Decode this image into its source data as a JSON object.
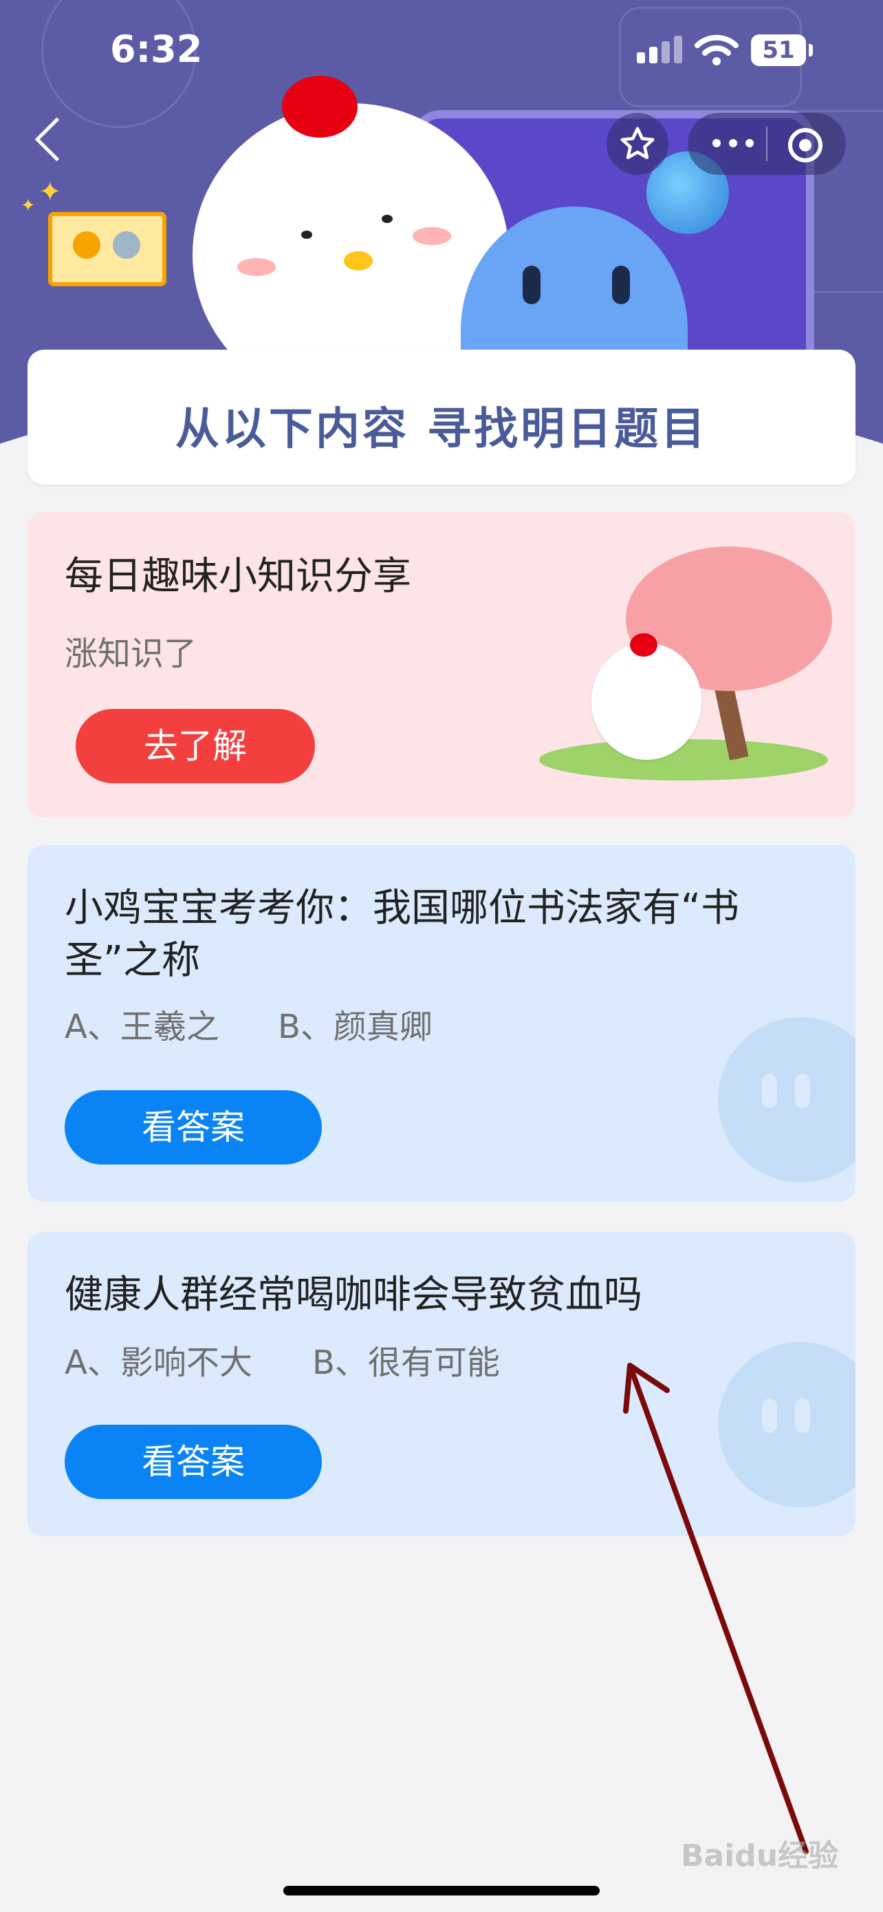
{
  "status_bar": {
    "time": "6:32",
    "battery": "51"
  },
  "banner": {
    "title": "从以下内容 寻找明日题目"
  },
  "cards": [
    {
      "title": "每日趣味小知识分享",
      "subtitle": "涨知识了",
      "button": "去了解"
    },
    {
      "title_line1": "小鸡宝宝考考你：我国哪位书法家有“书",
      "title_line2": "圣”之称",
      "option_a": "A、王羲之",
      "option_b": "B、颜真卿",
      "button": "看答案"
    },
    {
      "title": "健康人群经常喝咖啡会导致贫血吗",
      "option_a": "A、影响不大",
      "option_b": "B、很有可能",
      "button": "看答案"
    }
  ],
  "watermark": "Baidu经验",
  "colors": {
    "header_bg": "#5b5ba6",
    "pink_card": "#fde4e6",
    "blue_card": "#dbeafc",
    "red_button": "#f43f3f",
    "blue_button": "#0a84f5",
    "arrow": "#7a0a0a"
  },
  "icons": [
    "back-chevron-icon",
    "star-icon",
    "more-dots-icon",
    "target-icon",
    "wifi-icon",
    "signal-icon",
    "battery-icon",
    "medal-icon"
  ]
}
